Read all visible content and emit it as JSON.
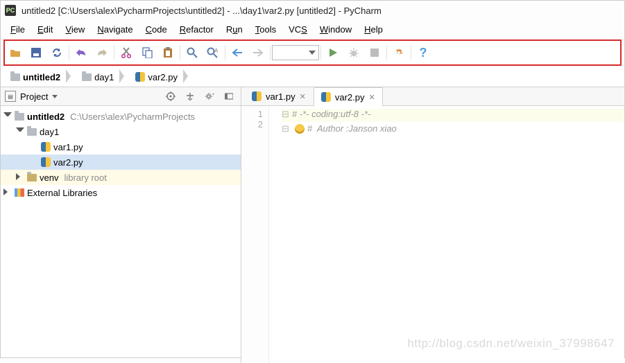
{
  "title": "untitled2 [C:\\Users\\alex\\PycharmProjects\\untitled2] - ...\\day1\\var2.py [untitled2] - PyCharm",
  "menu": {
    "items": [
      "File",
      "Edit",
      "View",
      "Navigate",
      "Code",
      "Refactor",
      "Run",
      "Tools",
      "VCS",
      "Window",
      "Help"
    ]
  },
  "breadcrumb": {
    "items": [
      "untitled2",
      "day1",
      "var2.py"
    ]
  },
  "project_panel": {
    "title": "Project",
    "tree": {
      "root": {
        "name": "untitled2",
        "path": "C:\\Users\\alex\\PycharmProjects"
      },
      "day1": {
        "name": "day1"
      },
      "files": [
        "var1.py",
        "var2.py"
      ],
      "venv": {
        "name": "venv",
        "note": "library root"
      },
      "ext": "External Libraries"
    }
  },
  "tabs": {
    "items": [
      {
        "label": "var1.py",
        "active": false
      },
      {
        "label": "var2.py",
        "active": true
      }
    ]
  },
  "editor": {
    "gutter": [
      "1",
      "2"
    ],
    "lines": [
      "# -*- coding:utf-8 -*-",
      "#  Author :Janson xiao"
    ]
  },
  "watermark": "http://blog.csdn.net/weixin_37998647",
  "icons": {
    "toolbar": [
      "open",
      "save",
      "sync",
      "undo",
      "redo",
      "cut",
      "copy",
      "paste",
      "find",
      "find-in-path",
      "back",
      "forward",
      "run-config",
      "run",
      "debug",
      "stop",
      "settings",
      "help"
    ]
  }
}
